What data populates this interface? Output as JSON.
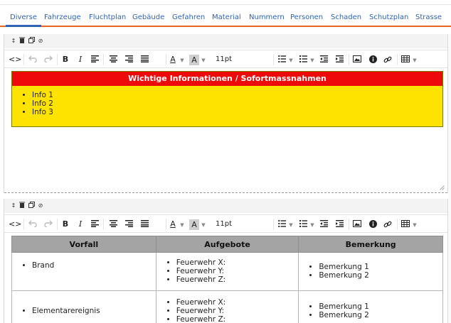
{
  "tabs": [
    {
      "label": "Diverse",
      "active": true
    },
    {
      "label": "Fahrzeuge"
    },
    {
      "label": "Fluchtplan"
    },
    {
      "label": "Gebäude"
    },
    {
      "label": "Gefahren"
    },
    {
      "label": "Material"
    },
    {
      "label": "Nummern"
    },
    {
      "label": "Personen"
    },
    {
      "label": "Schaden"
    },
    {
      "label": "Schutzplan"
    },
    {
      "label": "Strasse"
    }
  ],
  "toolbar": {
    "font_size": "11pt",
    "icons": [
      "move-icon",
      "trash-icon",
      "copy-icon",
      "disable-icon",
      "source-code-icon",
      "undo-icon",
      "redo-icon",
      "bold-icon",
      "italic-icon",
      "align-left-icon",
      "align-center-icon",
      "align-right-icon",
      "justify-icon",
      "text-color-icon",
      "background-color-icon",
      "bullet-list-icon",
      "numbered-list-icon",
      "outdent-icon",
      "indent-icon",
      "image-icon",
      "info-icon",
      "link-icon",
      "table-icon"
    ],
    "bold": "B",
    "italic": "I",
    "source": "<>",
    "text_color": "A",
    "bg_color": "A"
  },
  "block1": {
    "header": "Wichtige Informationen / Sofortmassnahmen",
    "items": [
      "Info 1",
      "Info 2",
      "Info 3"
    ],
    "colors": {
      "header": "#ee0a0a",
      "body": "#ffe300"
    }
  },
  "block2": {
    "columns": [
      "Vorfall",
      "Aufgebote",
      "Bemerkung"
    ],
    "rows": [
      {
        "vorfall": "Brand",
        "aufgebote": [
          "Feuerwehr X:",
          "Feuerwehr Y:",
          "Feuerwehr Z:"
        ],
        "bemerkung": [
          "Bemerkung 1",
          "Bemerkung 2"
        ]
      },
      {
        "vorfall": "Elementarereignis",
        "aufgebote": [
          "Feuerwehr X:",
          "Feuerwehr Y:",
          "Feuerwehr Z:"
        ],
        "bemerkung": [
          "Bemerkung 1",
          "Bemerkung 2"
        ]
      }
    ]
  },
  "colors": {
    "tab_text": "#2f62b3",
    "tab_underline": "#e8632a"
  }
}
